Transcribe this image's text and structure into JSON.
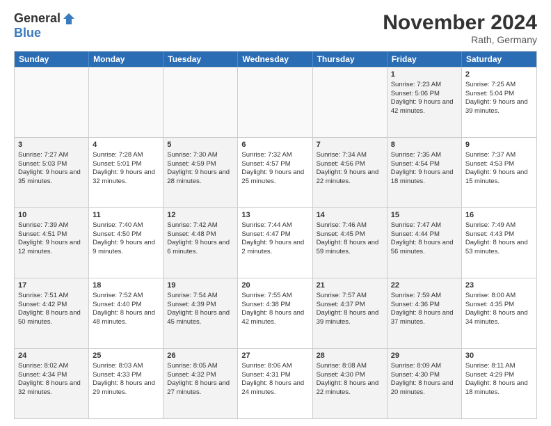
{
  "header": {
    "logo_general": "General",
    "logo_blue": "Blue",
    "month_title": "November 2024",
    "location": "Rath, Germany"
  },
  "weekdays": [
    "Sunday",
    "Monday",
    "Tuesday",
    "Wednesday",
    "Thursday",
    "Friday",
    "Saturday"
  ],
  "rows": [
    [
      {
        "day": "",
        "info": "",
        "empty": true
      },
      {
        "day": "",
        "info": "",
        "empty": true
      },
      {
        "day": "",
        "info": "",
        "empty": true
      },
      {
        "day": "",
        "info": "",
        "empty": true
      },
      {
        "day": "",
        "info": "",
        "empty": true
      },
      {
        "day": "1",
        "info": "Sunrise: 7:23 AM\nSunset: 5:06 PM\nDaylight: 9 hours and 42 minutes.",
        "shaded": true
      },
      {
        "day": "2",
        "info": "Sunrise: 7:25 AM\nSunset: 5:04 PM\nDaylight: 9 hours and 39 minutes.",
        "shaded": false
      }
    ],
    [
      {
        "day": "3",
        "info": "Sunrise: 7:27 AM\nSunset: 5:03 PM\nDaylight: 9 hours and 35 minutes.",
        "shaded": true
      },
      {
        "day": "4",
        "info": "Sunrise: 7:28 AM\nSunset: 5:01 PM\nDaylight: 9 hours and 32 minutes.",
        "shaded": false
      },
      {
        "day": "5",
        "info": "Sunrise: 7:30 AM\nSunset: 4:59 PM\nDaylight: 9 hours and 28 minutes.",
        "shaded": true
      },
      {
        "day": "6",
        "info": "Sunrise: 7:32 AM\nSunset: 4:57 PM\nDaylight: 9 hours and 25 minutes.",
        "shaded": false
      },
      {
        "day": "7",
        "info": "Sunrise: 7:34 AM\nSunset: 4:56 PM\nDaylight: 9 hours and 22 minutes.",
        "shaded": true
      },
      {
        "day": "8",
        "info": "Sunrise: 7:35 AM\nSunset: 4:54 PM\nDaylight: 9 hours and 18 minutes.",
        "shaded": true
      },
      {
        "day": "9",
        "info": "Sunrise: 7:37 AM\nSunset: 4:53 PM\nDaylight: 9 hours and 15 minutes.",
        "shaded": false
      }
    ],
    [
      {
        "day": "10",
        "info": "Sunrise: 7:39 AM\nSunset: 4:51 PM\nDaylight: 9 hours and 12 minutes.",
        "shaded": true
      },
      {
        "day": "11",
        "info": "Sunrise: 7:40 AM\nSunset: 4:50 PM\nDaylight: 9 hours and 9 minutes.",
        "shaded": false
      },
      {
        "day": "12",
        "info": "Sunrise: 7:42 AM\nSunset: 4:48 PM\nDaylight: 9 hours and 6 minutes.",
        "shaded": true
      },
      {
        "day": "13",
        "info": "Sunrise: 7:44 AM\nSunset: 4:47 PM\nDaylight: 9 hours and 2 minutes.",
        "shaded": false
      },
      {
        "day": "14",
        "info": "Sunrise: 7:46 AM\nSunset: 4:45 PM\nDaylight: 8 hours and 59 minutes.",
        "shaded": true
      },
      {
        "day": "15",
        "info": "Sunrise: 7:47 AM\nSunset: 4:44 PM\nDaylight: 8 hours and 56 minutes.",
        "shaded": true
      },
      {
        "day": "16",
        "info": "Sunrise: 7:49 AM\nSunset: 4:43 PM\nDaylight: 8 hours and 53 minutes.",
        "shaded": false
      }
    ],
    [
      {
        "day": "17",
        "info": "Sunrise: 7:51 AM\nSunset: 4:42 PM\nDaylight: 8 hours and 50 minutes.",
        "shaded": true
      },
      {
        "day": "18",
        "info": "Sunrise: 7:52 AM\nSunset: 4:40 PM\nDaylight: 8 hours and 48 minutes.",
        "shaded": false
      },
      {
        "day": "19",
        "info": "Sunrise: 7:54 AM\nSunset: 4:39 PM\nDaylight: 8 hours and 45 minutes.",
        "shaded": true
      },
      {
        "day": "20",
        "info": "Sunrise: 7:55 AM\nSunset: 4:38 PM\nDaylight: 8 hours and 42 minutes.",
        "shaded": false
      },
      {
        "day": "21",
        "info": "Sunrise: 7:57 AM\nSunset: 4:37 PM\nDaylight: 8 hours and 39 minutes.",
        "shaded": true
      },
      {
        "day": "22",
        "info": "Sunrise: 7:59 AM\nSunset: 4:36 PM\nDaylight: 8 hours and 37 minutes.",
        "shaded": true
      },
      {
        "day": "23",
        "info": "Sunrise: 8:00 AM\nSunset: 4:35 PM\nDaylight: 8 hours and 34 minutes.",
        "shaded": false
      }
    ],
    [
      {
        "day": "24",
        "info": "Sunrise: 8:02 AM\nSunset: 4:34 PM\nDaylight: 8 hours and 32 minutes.",
        "shaded": true
      },
      {
        "day": "25",
        "info": "Sunrise: 8:03 AM\nSunset: 4:33 PM\nDaylight: 8 hours and 29 minutes.",
        "shaded": false
      },
      {
        "day": "26",
        "info": "Sunrise: 8:05 AM\nSunset: 4:32 PM\nDaylight: 8 hours and 27 minutes.",
        "shaded": true
      },
      {
        "day": "27",
        "info": "Sunrise: 8:06 AM\nSunset: 4:31 PM\nDaylight: 8 hours and 24 minutes.",
        "shaded": false
      },
      {
        "day": "28",
        "info": "Sunrise: 8:08 AM\nSunset: 4:30 PM\nDaylight: 8 hours and 22 minutes.",
        "shaded": true
      },
      {
        "day": "29",
        "info": "Sunrise: 8:09 AM\nSunset: 4:30 PM\nDaylight: 8 hours and 20 minutes.",
        "shaded": true
      },
      {
        "day": "30",
        "info": "Sunrise: 8:11 AM\nSunset: 4:29 PM\nDaylight: 8 hours and 18 minutes.",
        "shaded": false
      }
    ]
  ]
}
